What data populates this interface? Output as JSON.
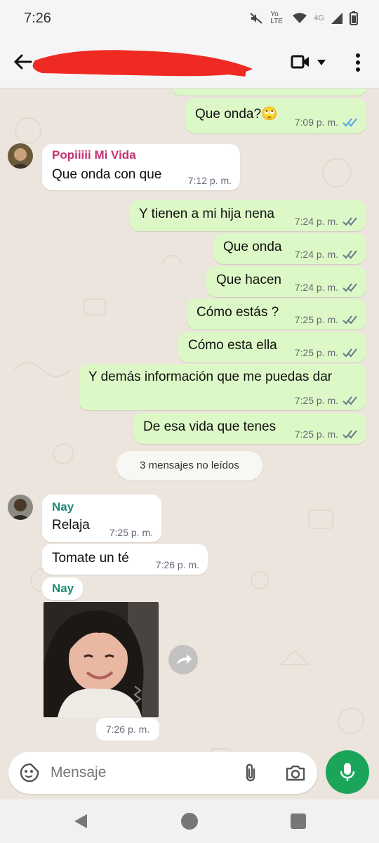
{
  "status_bar": {
    "time": "7:26",
    "network_lte": "Yo LTE",
    "network_4g": "4G"
  },
  "app_bar": {
    "contact_name_redacted": true
  },
  "colors": {
    "out_bubble": "#dcf8c6",
    "in_bubble": "#ffffff",
    "sender_popi": "#c43173",
    "sender_nay": "#1d8a73",
    "read_ticks": "#4fa5e8",
    "delivered_ticks": "#667788",
    "mic_button": "#1aa55a"
  },
  "messages": [
    {
      "text": "Que onda?🙄",
      "time": "7:09 p. m.",
      "ticks": "read"
    },
    {
      "sender": "Popiiiii Mi Vida",
      "text": "Que onda con que",
      "time": "7:12 p. m."
    },
    {
      "text": "Y tienen a mi hija nena",
      "time": "7:24 p. m.",
      "ticks": "delivered"
    },
    {
      "text": "Que onda",
      "time": "7:24 p. m.",
      "ticks": "delivered"
    },
    {
      "text": "Que hacen",
      "time": "7:24 p. m.",
      "ticks": "delivered"
    },
    {
      "text": "Cómo estás ?",
      "time": "7:25 p. m.",
      "ticks": "delivered"
    },
    {
      "text": "Cómo esta ella",
      "time": "7:25 p. m.",
      "ticks": "delivered"
    },
    {
      "text": "Y demás información que me puedas dar",
      "time": "7:25 p. m.",
      "ticks": "delivered"
    },
    {
      "text": "De esa vida que tenes",
      "time": "7:25 p. m.",
      "ticks": "delivered"
    },
    {
      "sender": "Nay",
      "text": "Relaja",
      "time": "7:25 p. m."
    },
    {
      "text": "Tomate un té",
      "time": "7:26 p. m."
    },
    {
      "sender": "Nay",
      "time": "7:26 p. m.",
      "media": "photo"
    }
  ],
  "unread_divider": "3 mensajes no leídos",
  "input": {
    "placeholder": "Mensaje",
    "value": ""
  },
  "icons": {
    "back": "arrow-left-icon",
    "video": "video-call-icon",
    "menu": "more-vertical-icon",
    "emoji": "sticker-icon",
    "attach": "paperclip-icon",
    "camera": "camera-icon",
    "mic": "microphone-icon",
    "forward": "forward-icon"
  }
}
